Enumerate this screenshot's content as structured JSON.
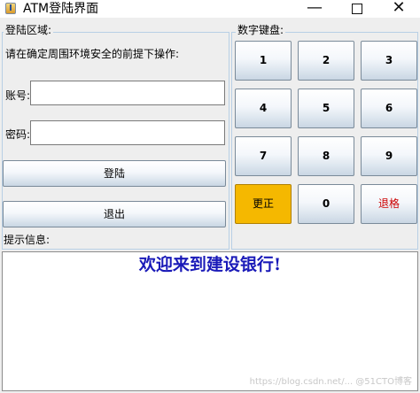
{
  "window": {
    "title": "ATM登陆界面",
    "min_glyph": "—",
    "close_glyph": "✕"
  },
  "login": {
    "group_label": "登陆区域:",
    "instruction": "请在确定周围环境安全的前提下操作:",
    "account_label": "账号:",
    "account_value": "",
    "password_label": "密码:",
    "password_value": "",
    "login_button": "登陆",
    "exit_button": "退出"
  },
  "keypad": {
    "group_label": "数字键盘:",
    "keys": [
      "1",
      "2",
      "3",
      "4",
      "5",
      "6",
      "7",
      "8",
      "9"
    ],
    "correct_label": "更正",
    "zero_label": "0",
    "backspace_label": "退格",
    "correct_color": "#f5b800",
    "backspace_text_color": "#cc0000"
  },
  "hint": {
    "label": "提示信息:",
    "message": "欢迎来到建设银行!",
    "message_color": "#1a1ab8"
  },
  "watermark": "https://blog.csdn.net/... @51CTO博客"
}
